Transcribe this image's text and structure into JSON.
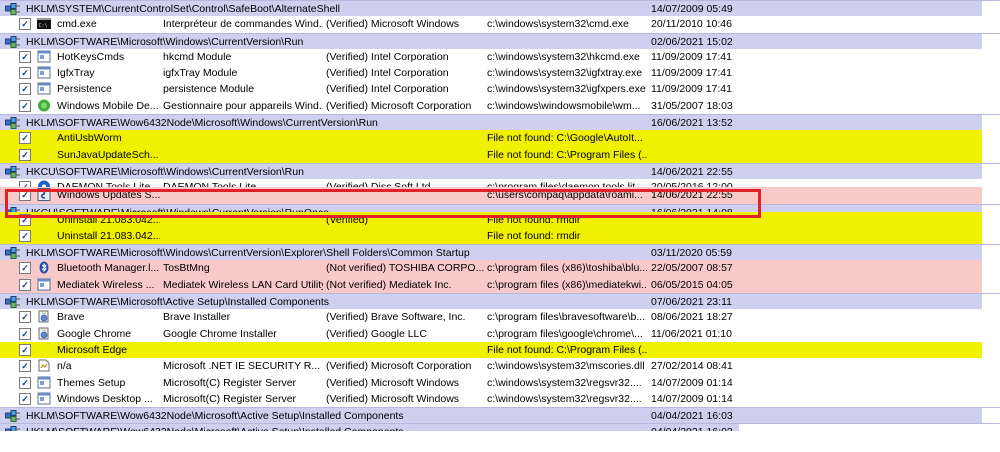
{
  "colors": {
    "group": "#cfcff0",
    "yellow": "#f0f000",
    "pink": "#f7c9c9",
    "highlight": "#e0202a",
    "check": "#1a3d8f"
  },
  "rows": [
    {
      "type": "group",
      "path": "HKLM\\SYSTEM\\CurrentControlSet\\Control\\SafeBoot\\AlternateShell",
      "time": "14/07/2009 05:49",
      "stripe": "group"
    },
    {
      "type": "entry",
      "bg": "white",
      "icon": "cmd-icon",
      "entry": "cmd.exe",
      "desc": "Interpréteur de commandes Wind...",
      "pub": "(Verified) Microsoft Windows",
      "path": "c:\\windows\\system32\\cmd.exe",
      "time": "20/11/2010 10:46",
      "stripe": "blank"
    },
    {
      "type": "group",
      "path": "HKLM\\SOFTWARE\\Microsoft\\Windows\\CurrentVersion\\Run",
      "time": "02/06/2021 15:02",
      "stripe": "group"
    },
    {
      "type": "entry",
      "bg": "white",
      "icon": "app-icon",
      "entry": "HotKeysCmds",
      "desc": "hkcmd Module",
      "pub": "(Verified) Intel Corporation",
      "path": "c:\\windows\\system32\\hkcmd.exe",
      "time": "11/09/2009 17:41",
      "stripe": "blank"
    },
    {
      "type": "entry",
      "bg": "white",
      "icon": "app-icon",
      "entry": "IgfxTray",
      "desc": "igfxTray Module",
      "pub": "(Verified) Intel Corporation",
      "path": "c:\\windows\\system32\\igfxtray.exe",
      "time": "11/09/2009 17:41",
      "stripe": "blank"
    },
    {
      "type": "entry",
      "bg": "white",
      "icon": "app-icon",
      "entry": "Persistence",
      "desc": "persistence Module",
      "pub": "(Verified) Intel Corporation",
      "path": "c:\\windows\\system32\\igfxpers.exe",
      "time": "11/09/2009 17:41",
      "stripe": "blank"
    },
    {
      "type": "entry",
      "bg": "white",
      "icon": "mobile-device-icon",
      "entry": "Windows Mobile De...",
      "desc": "Gestionnaire pour appareils Wind...",
      "pub": "(Verified) Microsoft Corporation",
      "path": "c:\\windows\\windowsmobile\\wm...",
      "time": "31/05/2007 18:03",
      "stripe": "blank"
    },
    {
      "type": "group",
      "path": "HKLM\\SOFTWARE\\Wow6432Node\\Microsoft\\Windows\\CurrentVersion\\Run",
      "time": "16/06/2021 13:52",
      "stripe": "group"
    },
    {
      "type": "entry",
      "bg": "yellow",
      "icon": "blank-icon",
      "entry": "AntiUsbWorm",
      "desc": "",
      "pub": "",
      "path": "File not found: C:\\Google\\AutoIt...",
      "time": "",
      "stripe": "yellow"
    },
    {
      "type": "entry",
      "bg": "yellow",
      "icon": "blank-icon",
      "entry": "SunJavaUpdateSch...",
      "desc": "",
      "pub": "",
      "path": "File not found: C:\\Program Files (...",
      "time": "",
      "stripe": "yellow"
    },
    {
      "type": "group",
      "path": "HKCU\\SOFTWARE\\Microsoft\\Windows\\CurrentVersion\\Run",
      "time": "14/06/2021 22:55",
      "stripe": "group"
    },
    {
      "type": "entry",
      "bg": "white",
      "icon": "daemon-tools-icon",
      "entry": "DAEMON Tools Lite",
      "desc": "DAEMON Tools Lite",
      "pub": "(Verified) Disc Soft Ltd",
      "path": "c:\\program files\\daemon tools lit...",
      "time": "20/05/2016 12:00",
      "stripe": "blank",
      "partial": true
    },
    {
      "type": "entry",
      "bg": "pink",
      "icon": "windows-updates-icon",
      "entry": "Windows Updates S...",
      "desc": "",
      "pub": "",
      "path": "c:\\users\\compaq\\appdata\\roami...",
      "time": "14/06/2021 22:55",
      "stripe": "pink"
    },
    {
      "type": "group",
      "path": "HKCU\\SOFTWARE\\Microsoft\\Windows\\CurrentVersion\\RunOnce",
      "time": "16/06/2021 14:08",
      "stripe": "group",
      "partial": true
    },
    {
      "type": "entry",
      "bg": "yellow",
      "icon": "blank-icon",
      "entry": "Uninstall 21.083.042...",
      "desc": "",
      "pub": "(Verified)",
      "path": "File not found: rmdir",
      "time": "",
      "stripe": "yellow"
    },
    {
      "type": "entry",
      "bg": "yellow",
      "icon": "blank-icon",
      "entry": "Uninstall 21.083.042...",
      "desc": "",
      "pub": "",
      "path": "File not found: rmdir",
      "time": "",
      "stripe": "yellow"
    },
    {
      "type": "group",
      "path": "HKLM\\SOFTWARE\\Microsoft\\Windows\\CurrentVersion\\Explorer\\Shell Folders\\Common Startup",
      "time": "03/11/2020 05:59",
      "stripe": "group"
    },
    {
      "type": "entry",
      "bg": "pink",
      "icon": "bluetooth-icon",
      "entry": "Bluetooth Manager.l...",
      "desc": "TosBtMng",
      "pub": "(Not verified) TOSHIBA CORPO...",
      "path": "c:\\program files (x86)\\toshiba\\blu...",
      "time": "22/05/2007 08:57",
      "stripe": "pink"
    },
    {
      "type": "entry",
      "bg": "pink",
      "icon": "app-icon",
      "entry": "Mediatek Wireless ...",
      "desc": "Mediatek Wireless LAN Card Utility",
      "pub": "(Not verified) Mediatek Inc.",
      "path": "c:\\program files (x86)\\mediatekwi...",
      "time": "06/05/2015 04:05",
      "stripe": "pink"
    },
    {
      "type": "group",
      "path": "HKLM\\SOFTWARE\\Microsoft\\Active Setup\\Installed Components",
      "time": "07/06/2021 23:11",
      "stripe": "group"
    },
    {
      "type": "entry",
      "bg": "white",
      "icon": "installer-icon",
      "entry": "Brave",
      "desc": "Brave Installer",
      "pub": "(Verified) Brave Software, Inc.",
      "path": "c:\\program files\\bravesoftware\\b...",
      "time": "08/06/2021 18:27",
      "stripe": "blank"
    },
    {
      "type": "entry",
      "bg": "white",
      "icon": "installer-icon",
      "entry": "Google Chrome",
      "desc": "Google Chrome Installer",
      "pub": "(Verified) Google LLC",
      "path": "c:\\program files\\google\\chrome\\...",
      "time": "11/06/2021 01:10",
      "stripe": "blank"
    },
    {
      "type": "entry",
      "bg": "yellow",
      "icon": "blank-icon",
      "entry": "Microsoft Edge",
      "desc": "",
      "pub": "",
      "path": "File not found: C:\\Program Files (...",
      "time": "",
      "stripe": "yellow"
    },
    {
      "type": "entry",
      "bg": "white",
      "icon": "document-icon",
      "entry": "n/a",
      "desc": "Microsoft .NET IE SECURITY R...",
      "pub": "(Verified) Microsoft Corporation",
      "path": "c:\\windows\\system32\\mscories.dll",
      "time": "27/02/2014 08:41",
      "stripe": "blank"
    },
    {
      "type": "entry",
      "bg": "white",
      "icon": "app-icon",
      "entry": "Themes Setup",
      "desc": "Microsoft(C) Register Server",
      "pub": "(Verified) Microsoft Windows",
      "path": "c:\\windows\\system32\\regsvr32....",
      "time": "14/07/2009 01:14",
      "stripe": "blank"
    },
    {
      "type": "entry",
      "bg": "white",
      "icon": "app-icon",
      "entry": "Windows Desktop ...",
      "desc": "Microsoft(C) Register Server",
      "pub": "(Verified) Microsoft Windows",
      "path": "c:\\windows\\system32\\regsvr32....",
      "time": "14/07/2009 01:14",
      "stripe": "blank"
    },
    {
      "type": "group",
      "path": "HKLM\\SOFTWARE\\Wow6432Node\\Microsoft\\Active Setup\\Installed Components",
      "time": "04/04/2021 16:03",
      "stripe": "group"
    },
    {
      "type": "group",
      "path": "HKLM\\SOFTWARE\\Wow6432Node\\Microsoft\\Active Setup\\Installed Components",
      "time": "04/04/2021 16:03",
      "stripe": "blank",
      "partial": true
    }
  ]
}
